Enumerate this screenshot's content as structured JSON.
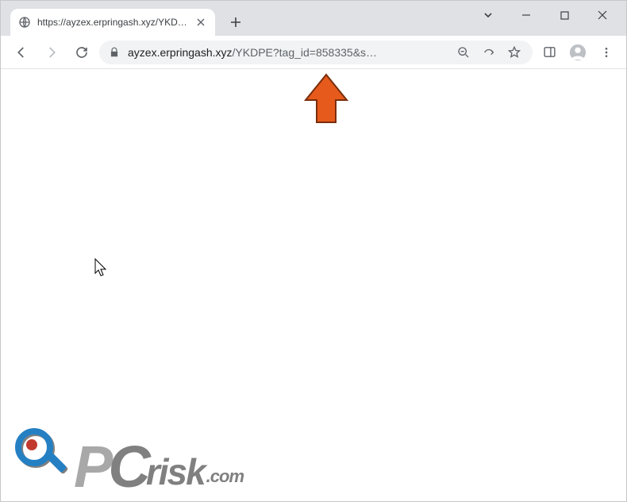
{
  "window": {
    "dropdown_icon": "chevron-down",
    "min_icon": "minimize",
    "max_icon": "maximize",
    "close_icon": "close"
  },
  "tab": {
    "title": "https://ayzex.erpringash.xyz/YKDPE",
    "favicon": "globe"
  },
  "toolbar": {
    "back": "back",
    "forward": "forward",
    "reload": "reload",
    "lock": "lock",
    "url_host": "ayzex.erpringash.xyz",
    "url_path": "/YKDPE?tag_id=858335&s…",
    "zoom": "zoom",
    "share": "share",
    "bookmark": "star",
    "panel": "side-panel",
    "profile": "profile",
    "menu": "menu"
  },
  "content": {
    "pointer": "arrow-pointer",
    "cursor": "mouse-cursor"
  },
  "watermark": {
    "p": "P",
    "c": "C",
    "risk": "risk",
    "com": ".com"
  }
}
